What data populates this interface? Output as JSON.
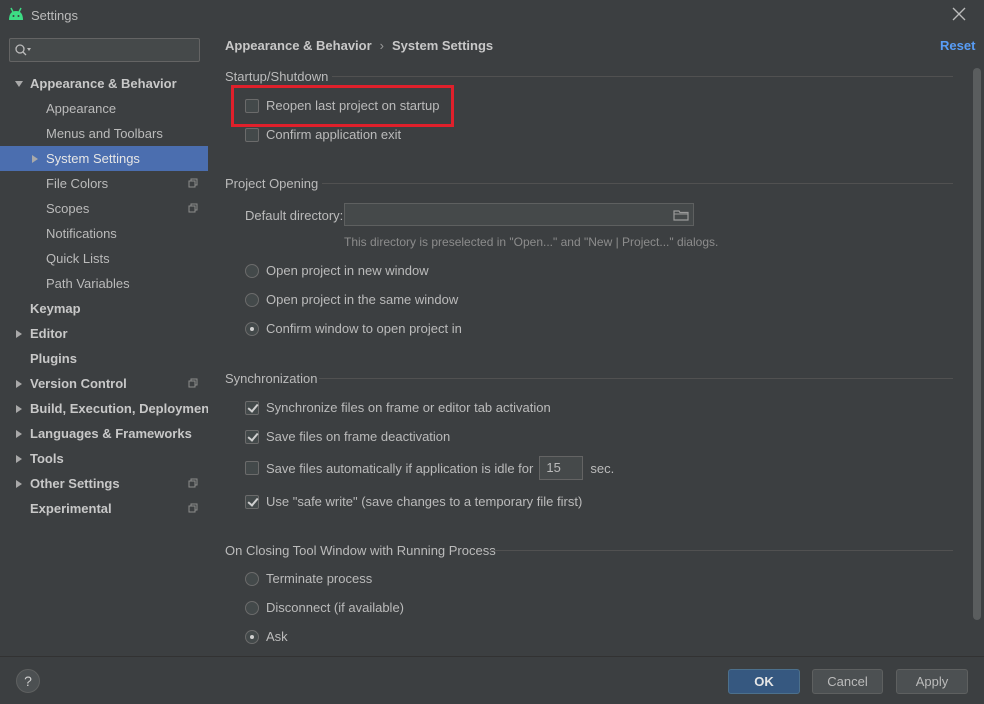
{
  "window": {
    "title": "Settings",
    "icon": "android-icon"
  },
  "search": {
    "placeholder": "",
    "value": ""
  },
  "sidebar": {
    "items": [
      {
        "label": "Appearance & Behavior",
        "level": 0,
        "bold": true,
        "expanded": true
      },
      {
        "label": "Appearance",
        "level": 1
      },
      {
        "label": "Menus and Toolbars",
        "level": 1
      },
      {
        "label": "System Settings",
        "level": 1,
        "selected": true,
        "collapsed": true
      },
      {
        "label": "File Colors",
        "level": 1,
        "project_icon": true
      },
      {
        "label": "Scopes",
        "level": 1,
        "project_icon": true
      },
      {
        "label": "Notifications",
        "level": 1
      },
      {
        "label": "Quick Lists",
        "level": 1
      },
      {
        "label": "Path Variables",
        "level": 1
      },
      {
        "label": "Keymap",
        "level": 0,
        "bold": true
      },
      {
        "label": "Editor",
        "level": 0,
        "bold": true,
        "collapsed": true
      },
      {
        "label": "Plugins",
        "level": 0,
        "bold": true
      },
      {
        "label": "Version Control",
        "level": 0,
        "bold": true,
        "collapsed": true,
        "project_icon": true
      },
      {
        "label": "Build, Execution, Deployment",
        "level": 0,
        "bold": true,
        "collapsed": true
      },
      {
        "label": "Languages & Frameworks",
        "level": 0,
        "bold": true,
        "collapsed": true
      },
      {
        "label": "Tools",
        "level": 0,
        "bold": true,
        "collapsed": true
      },
      {
        "label": "Other Settings",
        "level": 0,
        "bold": true,
        "collapsed": true,
        "project_icon": true
      },
      {
        "label": "Experimental",
        "level": 0,
        "bold": true,
        "project_icon": true
      }
    ]
  },
  "breadcrumb": {
    "parent": "Appearance & Behavior",
    "separator": "›",
    "current": "System Settings"
  },
  "reset_label": "Reset",
  "startup": {
    "title": "Startup/Shutdown",
    "reopen_label": "Reopen last project on startup",
    "reopen_checked": false,
    "confirm_exit_label": "Confirm application exit",
    "confirm_exit_checked": false
  },
  "project_opening": {
    "title": "Project Opening",
    "default_dir_label": "Default directory:",
    "default_dir_value": "",
    "hint": "This directory is preselected in \"Open...\" and \"New | Project...\" dialogs.",
    "options": [
      "Open project in new window",
      "Open project in the same window",
      "Confirm window to open project in"
    ],
    "selected_index": 2
  },
  "sync": {
    "title": "Synchronization",
    "sync_files_label": "Synchronize files on frame or editor tab activation",
    "sync_files_checked": true,
    "save_deactivation_label": "Save files on frame deactivation",
    "save_deactivation_checked": true,
    "save_idle_label": "Save files automatically if application is idle for",
    "save_idle_checked": false,
    "save_idle_value": "15",
    "save_idle_unit": "sec.",
    "safe_write_label": "Use \"safe write\" (save changes to a temporary file first)",
    "safe_write_checked": true
  },
  "closing": {
    "title": "On Closing Tool Window with Running Process",
    "options": [
      "Terminate process",
      "Disconnect (if available)",
      "Ask"
    ],
    "selected_index": 2
  },
  "footer": {
    "help_label": "?",
    "ok_label": "OK",
    "cancel_label": "Cancel",
    "apply_label": "Apply"
  },
  "colors": {
    "background": "#3c3f41",
    "selection": "#4b6eaf",
    "link": "#589df6",
    "primary_button": "#365880",
    "highlight_box": "#e0202b"
  }
}
